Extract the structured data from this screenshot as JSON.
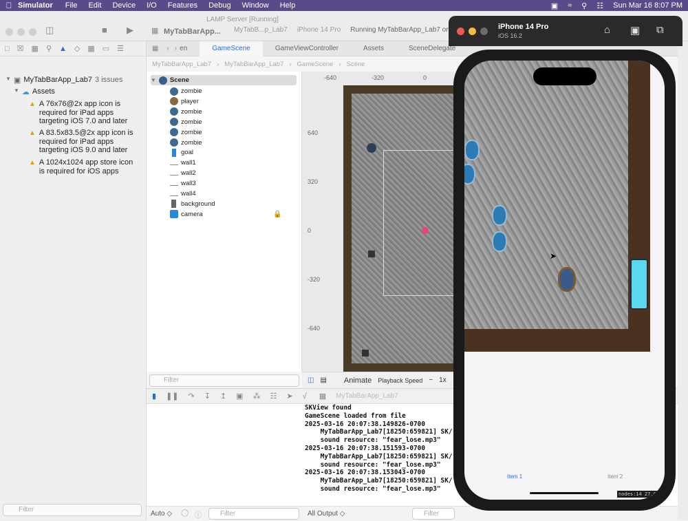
{
  "menubar": {
    "app": "Simulator",
    "items": [
      "File",
      "Edit",
      "Device",
      "I/O",
      "Features",
      "Debug",
      "Window",
      "Help"
    ],
    "clock": "Sun Mar 16  8:07 PM"
  },
  "toolbar": {
    "project_title": "MyTabBarApp...",
    "status_top": "LAMP Server [Running]",
    "scheme": "MyTabB...p_Lab7",
    "device": "iPhone 14 Pro",
    "run_status": "Running MyTabBarApp_Lab7 on"
  },
  "navigator": {
    "project": "MyTabBarApp_Lab7",
    "issues": "3 issues",
    "group": "Assets",
    "warnings": [
      "A 76x76@2x app icon is required for iPad apps targeting iOS 7.0 and later",
      "A 83.5x83.5@2x app icon is required for iPad apps targeting iOS 9.0 and later",
      "A 1024x1024 app store icon is required for iOS apps"
    ],
    "filter_placeholder": "Filter"
  },
  "tabs": [
    "en",
    "GameScene",
    "GameViewController",
    "Assets",
    "SceneDelegate"
  ],
  "breadcrumb": [
    "MyTabBarApp_Lab7",
    "MyTabBarApp_Lab7",
    "GameScene",
    "Scene"
  ],
  "outline": {
    "root": "Scene",
    "nodes": [
      "zombie",
      "player",
      "zombie",
      "zombie",
      "zombie",
      "zombie",
      "goal",
      "wall1",
      "wall2",
      "wall3",
      "wall4",
      "background",
      "camera"
    ],
    "filter_placeholder": "Filter"
  },
  "rulers": {
    "h": [
      "-640",
      "-320",
      "0"
    ],
    "v": [
      "640",
      "320",
      "0",
      "-320",
      "-640"
    ]
  },
  "editor_bar": {
    "animate": "Animate",
    "playback": "Playback Speed",
    "minus": "−",
    "speed": "1x"
  },
  "debug": {
    "target": "MyTabBarApp_Lab7",
    "console": [
      "SKView found",
      "GameScene loaded from file",
      "2025-03-16 20:07:38.149826-0700",
      "    MyTabBarApp_Lab7[18250:659821] SK/",
      "    sound resource: \"fear_lose.mp3\"",
      "2025-03-16 20:07:38.151593-0700",
      "    MyTabBarApp_Lab7[18250:659821] SK/",
      "    sound resource: \"fear_lose.mp3\"",
      "2025-03-16 20:07:38.153043-0700",
      "    MyTabBarApp_Lab7[18250:659821] SK/",
      "    sound resource: \"fear_lose.mp3\""
    ],
    "auto": "Auto ◇",
    "filter_placeholder": "Filter",
    "output": "All Output ◇",
    "filter2_placeholder": "Filter"
  },
  "simulator": {
    "device": "iPhone 14 Pro",
    "os": "iOS 16.2",
    "tab1": "Item 1",
    "tab2": "Item 2",
    "stats": "nodes:14  27.0"
  },
  "colors": {
    "menubar": "#5b4a8a",
    "accent": "#2a6ae0",
    "warning": "#e0a000"
  }
}
